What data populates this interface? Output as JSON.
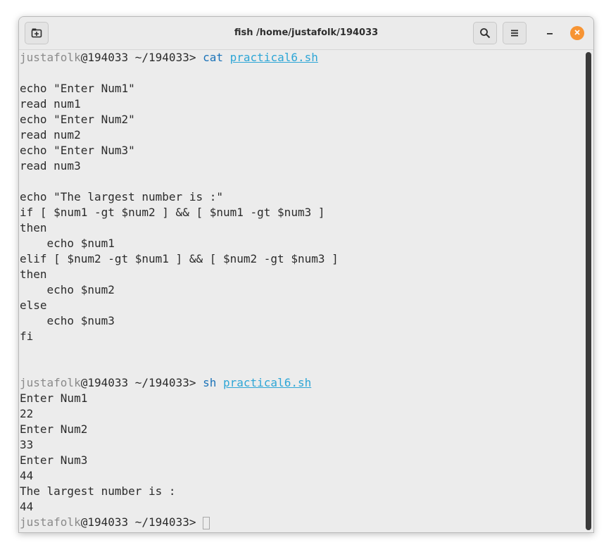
{
  "window": {
    "title": "fish /home/justafolk/194033"
  },
  "icons": {
    "new_tab": "new-tab-icon",
    "search": "search-icon",
    "menu": "hamburger-menu-icon",
    "minimize": "minimize-icon",
    "close": "close-icon"
  },
  "colors": {
    "close_button": "#f79433",
    "prompt_user": "#8a8a8a",
    "command": "#1c73b8",
    "argument": "#2ea6d6",
    "background": "#ececec",
    "text": "#2b2b2b"
  },
  "prompt": {
    "user": "justafolk",
    "host_path": "@194033 ~/194033> "
  },
  "commands": [
    {
      "cmd": "cat",
      "arg": "practical6.sh"
    },
    {
      "cmd": "sh",
      "arg": "practical6.sh"
    }
  ],
  "script_lines": [
    "",
    "echo \"Enter Num1\"",
    "read num1",
    "echo \"Enter Num2\"",
    "read num2",
    "echo \"Enter Num3\"",
    "read num3",
    "",
    "echo \"The largest number is :\"",
    "if [ $num1 -gt $num2 ] && [ $num1 -gt $num3 ]",
    "then",
    "    echo $num1",
    "elif [ $num2 -gt $num1 ] && [ $num2 -gt $num3 ]",
    "then",
    "    echo $num2",
    "else",
    "    echo $num3",
    "fi",
    "",
    ""
  ],
  "output_lines": [
    "Enter Num1",
    "22",
    "Enter Num2",
    "33",
    "Enter Num3",
    "44",
    "The largest number is :",
    "44"
  ]
}
